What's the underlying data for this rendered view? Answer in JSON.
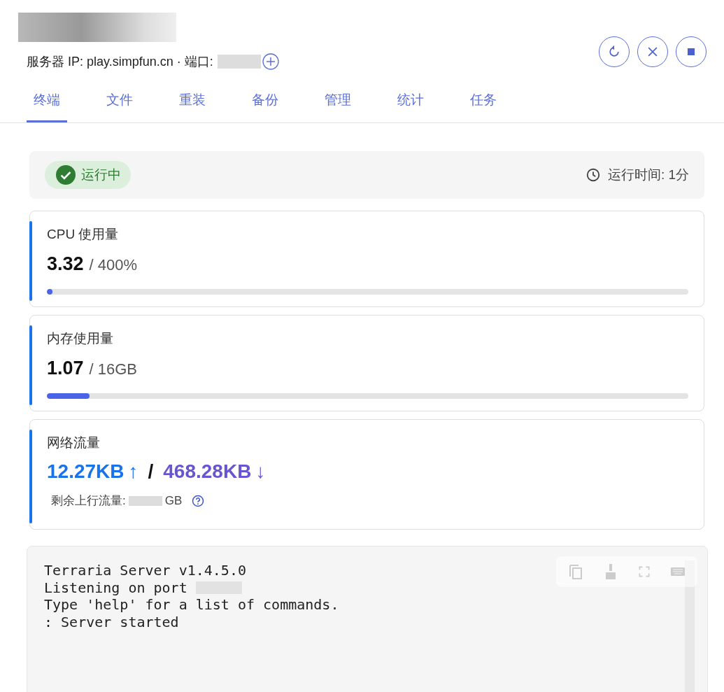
{
  "header": {
    "ip_line": "服务器 IP: play.simpfun.cn · 端口:",
    "actions": [
      {
        "kind": "restart"
      },
      {
        "kind": "kill"
      },
      {
        "kind": "stop"
      }
    ]
  },
  "tabs": [
    {
      "label": "终端",
      "selected": true
    },
    {
      "label": "文件",
      "selected": false
    },
    {
      "label": "重装",
      "selected": false
    },
    {
      "label": "备份",
      "selected": false
    },
    {
      "label": "管理",
      "selected": false
    },
    {
      "label": "统计",
      "selected": false
    },
    {
      "label": "任务",
      "selected": false
    }
  ],
  "status": {
    "label": "运行中",
    "running": true,
    "uptime": "运行时间: 1分"
  },
  "metrics": [
    {
      "title": "CPU 使用量",
      "value": "3.32",
      "total": "/ 400%",
      "level": 0.0083
    },
    {
      "title": "内存使用量",
      "value": "1.07",
      "total": "/ 16GB",
      "level": 0.067
    }
  ],
  "network": {
    "title": "网络流量",
    "up": "12.27KB",
    "up_arrow": "↑",
    "separator": "/",
    "down": "468.28KB",
    "down_arrow": "↓",
    "remaining_label": "剩余上行流量:",
    "remaining_unit": "GB"
  },
  "terminal": {
    "lines": [
      "Terraria Server v1.4.5.0",
      "Listening on port",
      "Type 'help' for a list of commands.",
      ": Server started"
    ],
    "tools": [
      {
        "kind": "copy"
      },
      {
        "kind": "clear"
      },
      {
        "kind": "fullscreen"
      },
      {
        "kind": "keyboard"
      }
    ]
  }
}
